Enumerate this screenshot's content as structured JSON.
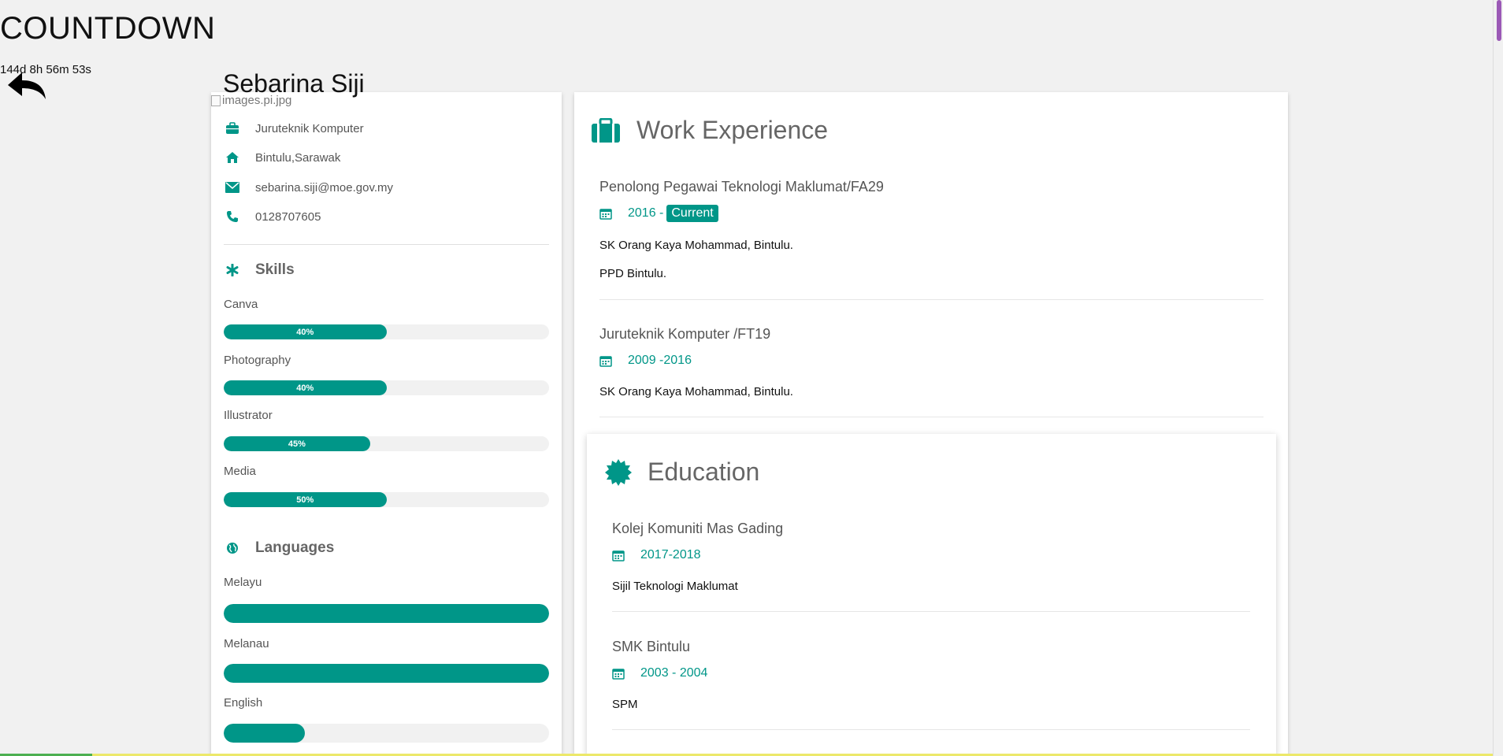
{
  "countdown": {
    "title": "COUNTDOWN",
    "value": "144d 8h 56m 53s"
  },
  "profile": {
    "name": "Sebarina Siji",
    "image_alt": "images.pi.jpg",
    "job": "Juruteknik Komputer",
    "location": "Bintulu,Sarawak",
    "email": "sebarina.siji@moe.gov.my",
    "phone": "0128707605"
  },
  "skills": {
    "heading": "Skills",
    "items": [
      {
        "label": "Canva",
        "percent": 50,
        "text": "40%"
      },
      {
        "label": "Photography",
        "percent": 50,
        "text": "40%"
      },
      {
        "label": "Illustrator",
        "percent": 45,
        "text": "45%"
      },
      {
        "label": "Media",
        "percent": 50,
        "text": "50%"
      }
    ]
  },
  "languages": {
    "heading": "Languages",
    "items": [
      {
        "label": "Melayu",
        "percent": 100
      },
      {
        "label": "Melanau",
        "percent": 100
      },
      {
        "label": "English",
        "percent": 25
      }
    ]
  },
  "work": {
    "heading": "Work Experience",
    "entries": [
      {
        "title": "Penolong Pegawai Teknologi Maklumat/FA29",
        "date": "2016 -",
        "tag": "Current",
        "lines": [
          "SK Orang Kaya Mohammad, Bintulu.",
          "PPD Bintulu."
        ]
      },
      {
        "title": "Juruteknik Komputer /FT19",
        "date": "2009 -2016",
        "tag": "",
        "lines": [
          "SK Orang Kaya Mohammad, Bintulu."
        ]
      }
    ]
  },
  "education": {
    "heading": "Education",
    "entries": [
      {
        "title": "Kolej Komuniti Mas Gading",
        "date": "2017-2018",
        "lines": [
          "Sijil Teknologi Maklumat"
        ]
      },
      {
        "title": "SMK Bintulu",
        "date": "2003 - 2004",
        "lines": [
          "SPM"
        ]
      }
    ]
  },
  "colors": {
    "accent": "#009688",
    "background": "#f1f1f1"
  },
  "icons": [
    "back-arrow-icon",
    "briefcase-icon",
    "home-icon",
    "envelope-icon",
    "phone-icon",
    "asterisk-icon",
    "globe-icon",
    "suitcase-icon",
    "calendar-icon",
    "certificate-icon"
  ]
}
